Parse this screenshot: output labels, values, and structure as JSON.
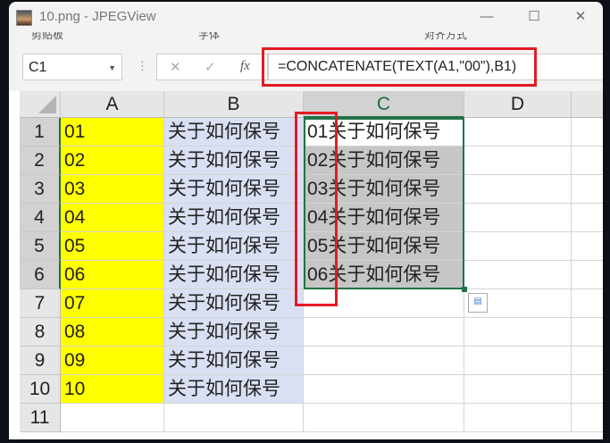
{
  "window": {
    "title": "10.png - JPEGView",
    "minimize": "—",
    "maximize": "☐",
    "close": "✕"
  },
  "ribbon": {
    "groups": [
      "剪贴板",
      "字体",
      "对齐方式"
    ]
  },
  "formula_bar": {
    "name_box": "C1",
    "cancel": "✕",
    "enter": "✓",
    "fx": "fx",
    "formula": "=CONCATENATE(TEXT(A1,\"00\"),B1)"
  },
  "columns": [
    "A",
    "B",
    "C",
    "D"
  ],
  "rows": [
    "1",
    "2",
    "3",
    "4",
    "5",
    "6",
    "7",
    "8",
    "9",
    "10",
    "11"
  ],
  "col_a": [
    "01",
    "02",
    "03",
    "04",
    "05",
    "06",
    "07",
    "08",
    "09",
    "10"
  ],
  "col_b": [
    "关于如何保号",
    "关于如何保号",
    "关于如何保号",
    "关于如何保号",
    "关于如何保号",
    "关于如何保号",
    "关于如何保号",
    "关于如何保号",
    "关于如何保号",
    "关于如何保号"
  ],
  "col_c": [
    "01关于如何保号",
    "02关于如何保号",
    "03关于如何保号",
    "04关于如何保号",
    "05关于如何保号",
    "06关于如何保号"
  ],
  "colors": {
    "col_a_fill": "#ffff00",
    "col_b_fill": "#dae0f3",
    "selection": "#217346",
    "highlight": "#e31b23"
  }
}
